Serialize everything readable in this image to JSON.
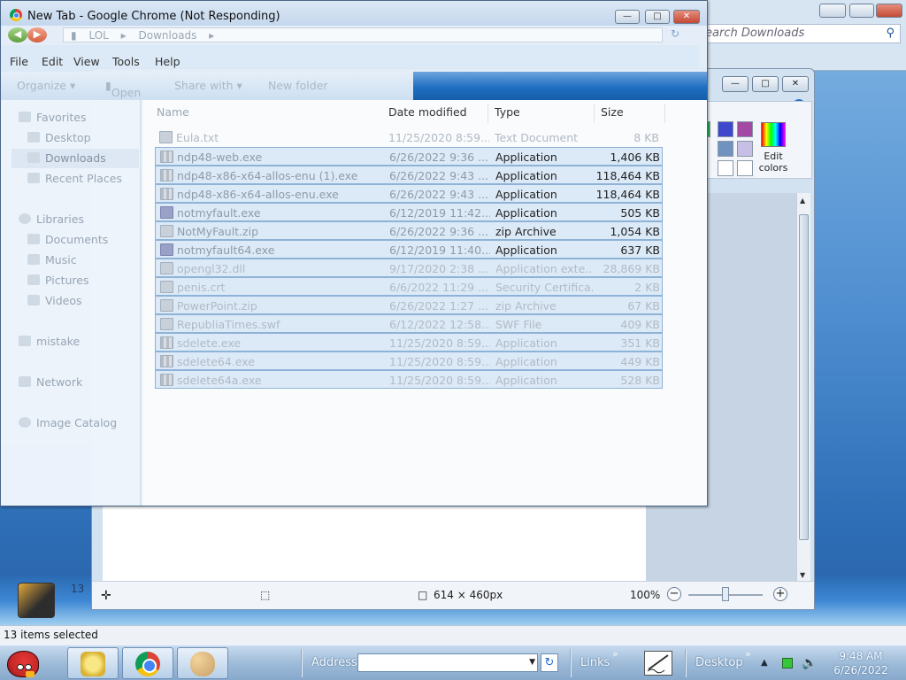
{
  "chrome_window": {
    "title": "New Tab - Google Chrome (Not Responding)",
    "breadcrumb": [
      "LOL",
      "Downloads"
    ],
    "menu": [
      "File",
      "Edit",
      "View",
      "Tools",
      "Help"
    ],
    "commands": [
      "Organize ▾",
      "Open",
      "Share with ▾",
      "New folder"
    ],
    "nav": {
      "favorites": "Favorites",
      "desktop": "Desktop",
      "downloads": "Downloads",
      "recent": "Recent Places",
      "libraries": "Libraries",
      "documents": "Documents",
      "music": "Music",
      "pictures": "Pictures",
      "videos": "Videos",
      "mistake": "mistake",
      "network": "Network",
      "image_catalog": "Image Catalog"
    },
    "columns": {
      "name": "Name",
      "date": "Date modified",
      "type": "Type",
      "size": "Size"
    },
    "files": [
      {
        "name": "Eula.txt",
        "date": "11/25/2020 8:59...",
        "type": "Text Document",
        "size": "8 KB"
      },
      {
        "name": "ndp48-web.exe",
        "date": "6/26/2022 9:36 ...",
        "type": "Application",
        "size": "1,406 KB"
      },
      {
        "name": "ndp48-x86-x64-allos-enu (1).exe",
        "date": "6/26/2022 9:43 ...",
        "type": "Application",
        "size": "118,464 KB"
      },
      {
        "name": "ndp48-x86-x64-allos-enu.exe",
        "date": "6/26/2022 9:43 ...",
        "type": "Application",
        "size": "118,464 KB"
      },
      {
        "name": "notmyfault.exe",
        "date": "6/12/2019 11:42...",
        "type": "Application",
        "size": "505 KB"
      },
      {
        "name": "NotMyFault.zip",
        "date": "6/26/2022 9:36 ...",
        "type": "zip Archive",
        "size": "1,054 KB"
      },
      {
        "name": "notmyfault64.exe",
        "date": "6/12/2019 11:40...",
        "type": "Application",
        "size": "637 KB"
      },
      {
        "name": "opengl32.dll",
        "date": "9/17/2020 2:38 ...",
        "type": "Application exte...",
        "size": "28,869 KB"
      },
      {
        "name": "penis.crt",
        "date": "6/6/2022 11:29 ...",
        "type": "Security Certifica...",
        "size": "2 KB"
      },
      {
        "name": "PowerPoint.zip",
        "date": "6/26/2022 1:27 ...",
        "type": "zip Archive",
        "size": "67 KB"
      },
      {
        "name": "RepubliaTimes.swf",
        "date": "6/12/2022 12:58...",
        "type": "SWF File",
        "size": "409 KB"
      },
      {
        "name": "sdelete.exe",
        "date": "11/25/2020 8:59...",
        "type": "Application",
        "size": "351 KB"
      },
      {
        "name": "sdelete64.exe",
        "date": "11/25/2020 8:59...",
        "type": "Application",
        "size": "449 KB"
      },
      {
        "name": "sdelete64a.exe",
        "date": "11/25/2020 8:59...",
        "type": "Application",
        "size": "528 KB"
      }
    ]
  },
  "search_window": {
    "placeholder": "earch Downloads"
  },
  "paint": {
    "edit_colors": "Edit colors",
    "dimensions": "614 × 460px",
    "zoom": "100%",
    "zoom_level": 100,
    "swatches": [
      "#3f48cc",
      "#a349a4",
      "#7092be",
      "#c8bfe7",
      "#ffffff",
      "#ffffff"
    ]
  },
  "status": {
    "selected": "13 items selected"
  },
  "desktop": {
    "badge": "13"
  },
  "taskbar": {
    "address_label": "Address",
    "links_label": "Links",
    "desktop_label": "Desktop",
    "time": "9:48 AM",
    "date": "6/26/2022"
  }
}
